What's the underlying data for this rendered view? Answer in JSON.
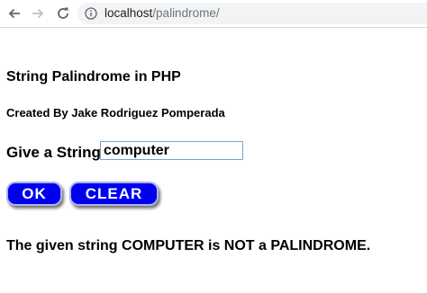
{
  "browser": {
    "url_host": "localhost",
    "url_path": "/palindrome/"
  },
  "page": {
    "heading": "String Palindrome in PHP",
    "author": "Created By Jake Rodriguez Pomperada",
    "prompt_label": "Give a String",
    "input_value": "computer",
    "ok_label": "OK",
    "clear_label": "CLEAR",
    "result_text": "The given string COMPUTER is NOT a PALINDROME.",
    "button_color": "#0000ee"
  }
}
